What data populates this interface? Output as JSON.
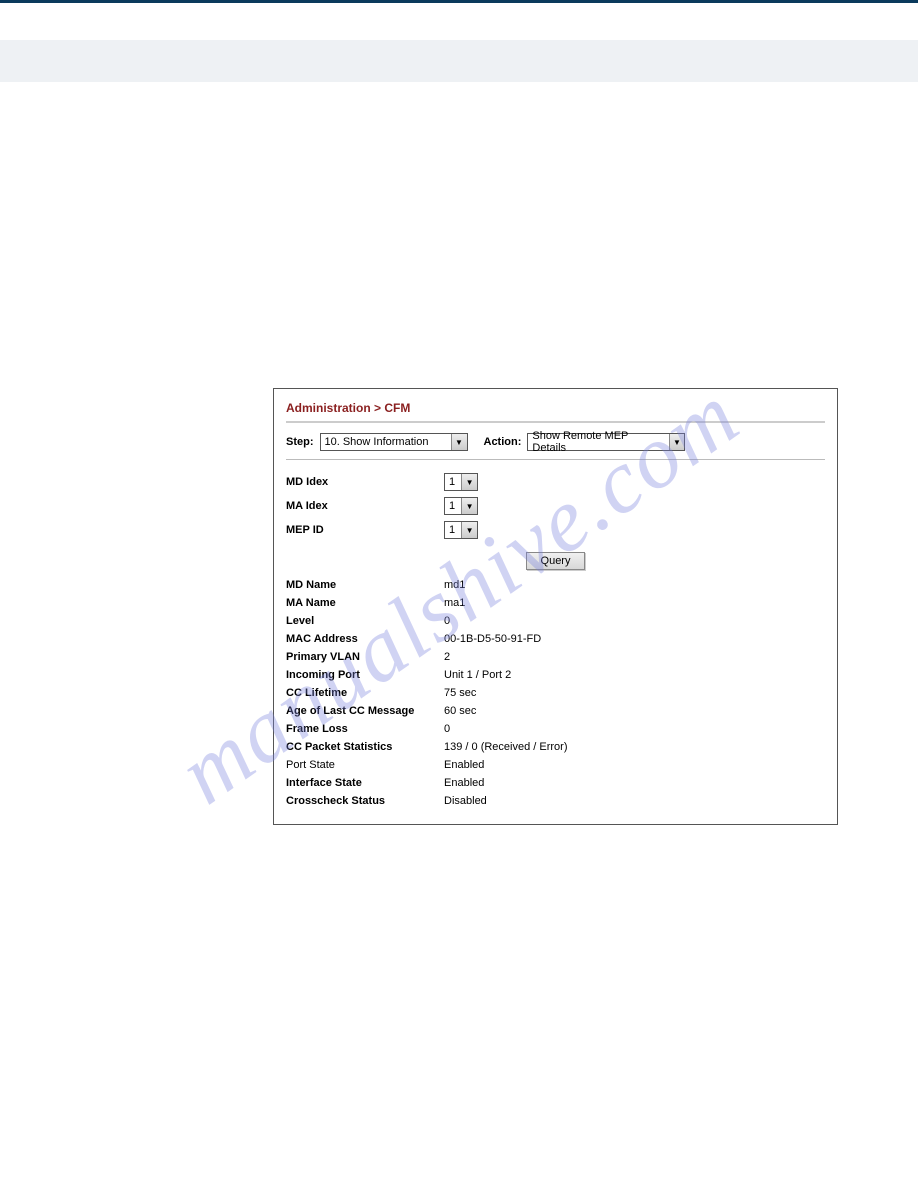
{
  "watermark": "manualshive.com",
  "breadcrumb": "Administration > CFM",
  "controls": {
    "step_label": "Step:",
    "step_value": "10. Show Information",
    "action_label": "Action:",
    "action_value": "Show Remote MEP Details"
  },
  "inputs": {
    "md_index_label": "MD Idex",
    "md_index_value": "1",
    "ma_index_label": "MA Idex",
    "ma_index_value": "1",
    "mep_id_label": "MEP ID",
    "mep_id_value": "1"
  },
  "query_button": "Query",
  "details": [
    {
      "label": "MD Name",
      "value": "md1",
      "bold": true
    },
    {
      "label": "MA Name",
      "value": "ma1",
      "bold": true
    },
    {
      "label": "Level",
      "value": "0",
      "bold": true
    },
    {
      "label": "MAC Address",
      "value": "00-1B-D5-50-91-FD",
      "bold": true
    },
    {
      "label": "Primary VLAN",
      "value": "2",
      "bold": true
    },
    {
      "label": "Incoming Port",
      "value": "Unit 1 / Port 2",
      "bold": true
    },
    {
      "label": "CC Lifetime",
      "value": "75 sec",
      "bold": true
    },
    {
      "label": "Age of Last CC Message",
      "value": "60 sec",
      "bold": true
    },
    {
      "label": "Frame Loss",
      "value": "0",
      "bold": true
    },
    {
      "label": "CC Packet Statistics",
      "value": "139 / 0 (Received / Error)",
      "bold": true
    },
    {
      "label": "Port State",
      "value": "Enabled",
      "bold": false
    },
    {
      "label": "Interface State",
      "value": "Enabled",
      "bold": true
    },
    {
      "label": "Crosscheck Status",
      "value": "Disabled",
      "bold": true
    }
  ]
}
